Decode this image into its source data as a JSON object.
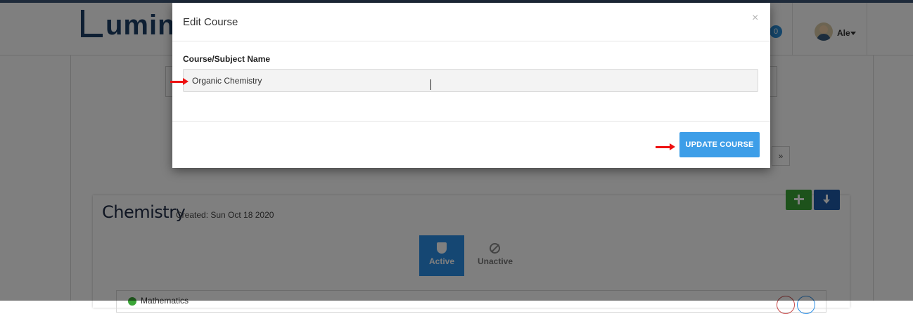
{
  "header": {
    "logo_text": "umin",
    "notifications_count": "0",
    "user_name": "Ale"
  },
  "pager": {
    "next_label": "»"
  },
  "course": {
    "title": "Chemistry",
    "created": "Created: Sun Oct 18 2020",
    "tabs": [
      {
        "label": "Active",
        "icon": "shield-check-icon",
        "selected": true
      },
      {
        "label": "Unactive",
        "icon": "ban-icon",
        "selected": false
      }
    ],
    "list_item_label": "Mathematics"
  },
  "modal": {
    "title": "Edit Course",
    "close_label": "×",
    "field_label": "Course/Subject Name",
    "field_value": "Organic Chemistry",
    "submit_label": "UPDATE COURSE"
  },
  "colors": {
    "primary_button": "#3d9ee8",
    "add_button": "#3aa537",
    "download_button": "#1e5aa8",
    "annotation_arrow": "#e11111"
  }
}
